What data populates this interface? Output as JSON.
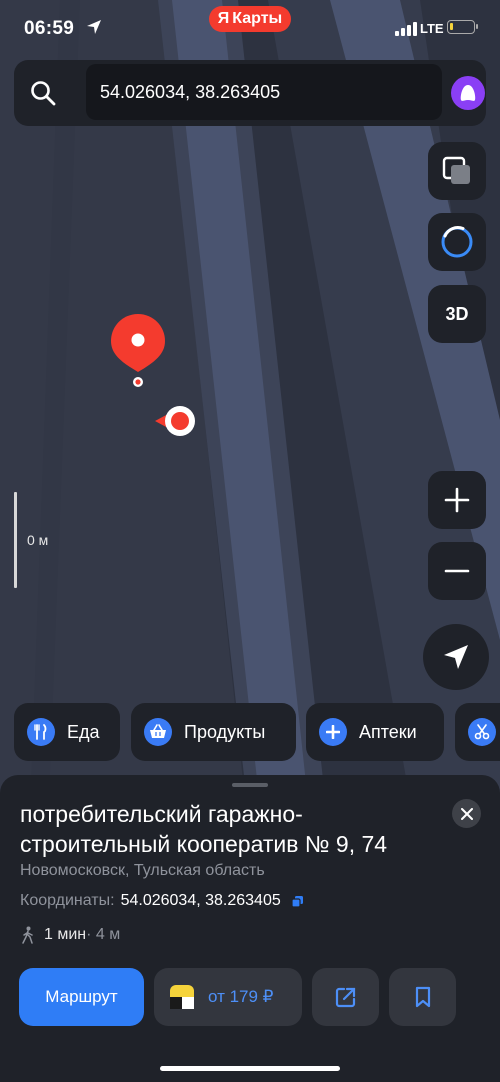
{
  "statusbar": {
    "time": "06:59",
    "network": "LTE",
    "battery_level": 0.12
  },
  "brand": {
    "logo": "Я",
    "name": "Карты"
  },
  "search": {
    "value": "54.026034, 38.263405"
  },
  "map_controls": {
    "layers_icon": "layers-icon",
    "alice_icon": "alice-icon",
    "view3d_label": "3D",
    "zoom_in": "+",
    "zoom_out": "−"
  },
  "scale": {
    "label": "0 м"
  },
  "categories": [
    {
      "label": "Еда",
      "icon": "fork-knife-icon"
    },
    {
      "label": "Продукты",
      "icon": "basket-icon"
    },
    {
      "label": "Аптеки",
      "icon": "plus-icon"
    },
    {
      "label": "",
      "icon": "scissors-icon"
    }
  ],
  "place": {
    "title": "потребительский гаражно-строительный кооператив № 9, 74",
    "subtitle": "Новомосковск, Тульская область",
    "coords_label": "Координаты:",
    "coords_value": "54.026034, 38.263405",
    "walk_time": "1 мин",
    "walk_distance": " · 4 м"
  },
  "actions": {
    "route_label": "Маршрут",
    "taxi_label": "от 179 ₽"
  },
  "colors": {
    "accent": "#2f7df6",
    "pin": "#f43b2e",
    "alice": "#8a3ff5",
    "sheet": "#1f2229"
  }
}
